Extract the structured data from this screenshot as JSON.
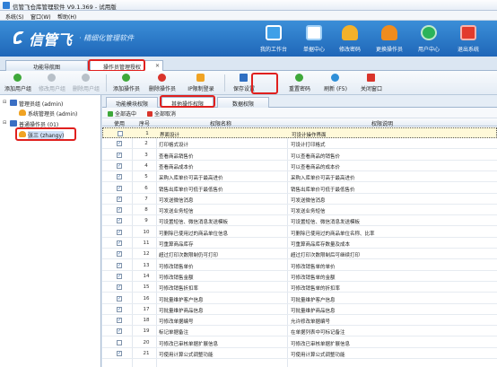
{
  "window": {
    "title": "信管飞仓库管理软件 V9.1.369 - 试用版"
  },
  "menu": [
    {
      "label": "系统(S)"
    },
    {
      "label": "窗口(W)"
    },
    {
      "label": "帮助(H)"
    }
  ],
  "banner": {
    "logo": "信管飞",
    "slogan": "· 精细化管理软件",
    "buttons": [
      {
        "label": "我的工作台",
        "icon": "monitor-icon",
        "color": "#3fa0e8"
      },
      {
        "label": "单据中心",
        "icon": "document-list-icon",
        "color": "#5fb2ee"
      },
      {
        "label": "修改密码",
        "icon": "user-key-icon",
        "color": "#f3b12a"
      },
      {
        "label": "更换操作员",
        "icon": "user-switch-icon",
        "color": "#f08c1e"
      },
      {
        "label": "用户中心",
        "icon": "globe-icon",
        "color": "#2bb35a"
      },
      {
        "label": "退出系统",
        "icon": "power-icon",
        "color": "#e23b2c"
      }
    ]
  },
  "tabs": [
    {
      "label": "功能导航图"
    },
    {
      "label": "操作员管理授权"
    }
  ],
  "toolbar": [
    {
      "label": "添加用户组",
      "icon": "add-icon",
      "color": "#3fa83a",
      "enabled": true
    },
    {
      "label": "修改用户组",
      "icon": "edit-icon",
      "color": "#b8c0c8",
      "enabled": false
    },
    {
      "label": "删除用户组",
      "icon": "delete-icon",
      "color": "#b8c0c8",
      "enabled": false
    },
    {
      "label": "添加操作员",
      "icon": "add-icon",
      "color": "#3fa83a",
      "enabled": true
    },
    {
      "label": "删除操作员",
      "icon": "delete-icon",
      "color": "#d9342b",
      "enabled": true
    },
    {
      "label": "IP限制登录",
      "icon": "lock-icon",
      "color": "#f0a323",
      "enabled": true
    },
    {
      "label": "保存设置",
      "icon": "save-icon",
      "color": "#2f6fc2",
      "enabled": true
    },
    {
      "label": "重置密码",
      "icon": "key-icon",
      "color": "#3fa83a",
      "enabled": true
    },
    {
      "label": "刷新 (F5)",
      "icon": "refresh-icon",
      "color": "#2f8fd8",
      "enabled": true
    },
    {
      "label": "关闭窗口",
      "icon": "close-icon",
      "color": "#d9342b",
      "enabled": true
    }
  ],
  "tree": [
    {
      "label": "管理员组 (admin)",
      "level": 0,
      "expander": "⊟"
    },
    {
      "label": "系统管理员 (admin)",
      "level": 1
    },
    {
      "label": "普通操作员 (01)",
      "level": 0,
      "expander": "⊟"
    },
    {
      "label": "张三 (zhangy)",
      "level": 1,
      "selected": true
    }
  ],
  "subtabs": [
    {
      "label": "功能模块权限"
    },
    {
      "label": "其他操作权限"
    },
    {
      "label": "数据权限"
    }
  ],
  "selection": {
    "select_all": "全部选中",
    "cancel_all": "全部取消"
  },
  "grid": {
    "headers": {
      "use": "使用",
      "no": "序号",
      "name": "权限名称",
      "desc": "权限说明"
    },
    "rows": [
      {
        "checked": false,
        "no": "1",
        "name": "界面设计",
        "desc": "可设计操作界面"
      },
      {
        "checked": true,
        "no": "2",
        "name": "打印格式设计",
        "desc": "可设计打印格式"
      },
      {
        "checked": true,
        "no": "3",
        "name": "查看商品销售价",
        "desc": "可以查看商品的销售价"
      },
      {
        "checked": true,
        "no": "4",
        "name": "查看商品成本价",
        "desc": "可以查看商品的成本价"
      },
      {
        "checked": true,
        "no": "5",
        "name": "采购入库单价可高于最高进价",
        "desc": "采购入库单价可高于最高进价"
      },
      {
        "checked": true,
        "no": "6",
        "name": "销售出库单价可低于最低售价",
        "desc": "销售出库单价可低于最低售价"
      },
      {
        "checked": true,
        "no": "7",
        "name": "可发送微信消息",
        "desc": "可发送微信消息"
      },
      {
        "checked": true,
        "no": "8",
        "name": "可发送业务短信",
        "desc": "可发送业务短信"
      },
      {
        "checked": true,
        "no": "9",
        "name": "可设置短信、微信消息发送模板",
        "desc": "可设置短信、微信消息发送模板"
      },
      {
        "checked": true,
        "no": "10",
        "name": "可删除已使用过的商品单位信息",
        "desc": "可删除已使用过的商品单位名称、比率"
      },
      {
        "checked": true,
        "no": "11",
        "name": "可重算商品库存",
        "desc": "可重算商品库存数量及成本"
      },
      {
        "checked": true,
        "no": "12",
        "name": "超过打印次数限制仍可打印",
        "desc": "超过打印次数限制后可继续打印"
      },
      {
        "checked": true,
        "no": "13",
        "name": "可修改销售单价",
        "desc": "可修改销售单的单价"
      },
      {
        "checked": true,
        "no": "14",
        "name": "可修改销售金额",
        "desc": "可修改销售单的金额"
      },
      {
        "checked": true,
        "no": "15",
        "name": "可修改销售折扣率",
        "desc": "可修改销售单的折扣率"
      },
      {
        "checked": true,
        "no": "16",
        "name": "可批量维护客户信息",
        "desc": "可批量维护客户信息"
      },
      {
        "checked": true,
        "no": "17",
        "name": "可批量维护商品信息",
        "desc": "可批量维护商品信息"
      },
      {
        "checked": true,
        "no": "18",
        "name": "可修改单据编号",
        "desc": "允许修改单据编号"
      },
      {
        "checked": true,
        "no": "19",
        "name": "标记单据备注",
        "desc": "在单据列表中可标记备注"
      },
      {
        "checked": false,
        "no": "20",
        "name": "可修改已审核单据扩展信息",
        "desc": "可修改已审核单据扩展信息"
      },
      {
        "checked": true,
        "no": "21",
        "name": "可使用计算公式调整功能",
        "desc": "可使用计算公式调整功能"
      }
    ]
  },
  "colors": {
    "highlight": "#e0201e",
    "banner": "#2a7ac9"
  }
}
